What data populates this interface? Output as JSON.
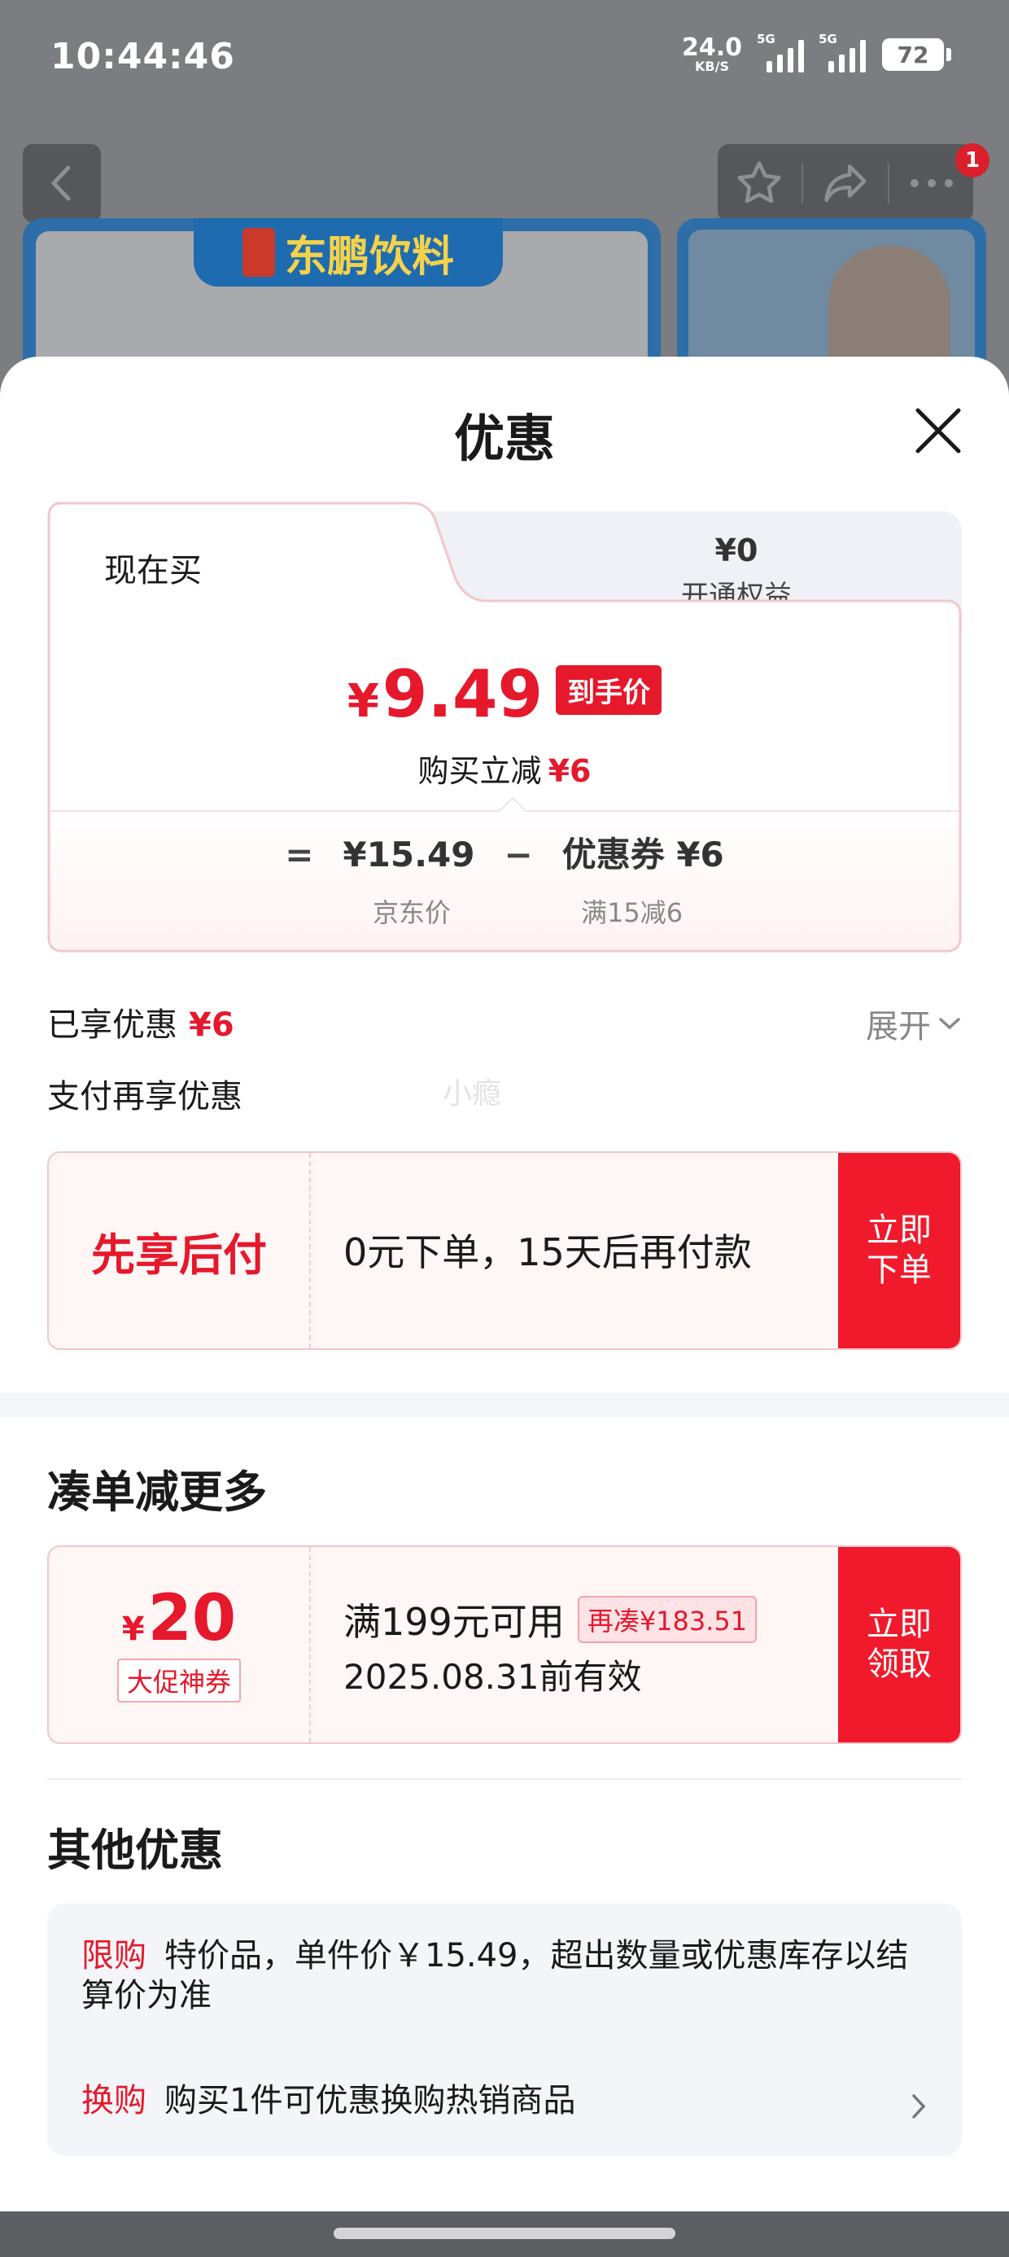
{
  "status_bar": {
    "time": "10:44:46",
    "net_speed": "24.0",
    "net_unit": "KB/S",
    "sim1": "5G",
    "sim2": "5G",
    "battery": "72"
  },
  "background": {
    "badge_count": "1",
    "brand_name": "东鹏饮料"
  },
  "sheet": {
    "title": "优惠",
    "close_icon": "close-icon"
  },
  "price_card": {
    "tab_now": "现在买",
    "tab_member_price": "¥0",
    "tab_member_label": "开通权益",
    "currency": "¥",
    "final_price": "9.49",
    "final_tag": "到手价",
    "reduce_label": "购买立减",
    "reduce_value": "¥6",
    "formula_eq": "=",
    "base_price": "¥15.49",
    "formula_minus": "−",
    "coupon_label": "优惠券 ¥6",
    "base_price_label": "京东价",
    "coupon_rule": "满15减6"
  },
  "enjoyed": {
    "label": "已享优惠",
    "value": "¥6",
    "expand": "展开"
  },
  "pay_section": {
    "label": "支付再享优惠",
    "watermark": "小瘾",
    "title": "先享后付",
    "desc": "0元下单，15天后再付款",
    "cta": "立即\n下单"
  },
  "bundle_section": {
    "title": "凑单减更多",
    "currency": "¥",
    "amount": "20",
    "tag": "大促神券",
    "rule": "满199元可用",
    "pill": "再凑¥183.51",
    "expiry": "2025.08.31前有效",
    "cta": "立即\n领取"
  },
  "other_section": {
    "title": "其他优惠",
    "items": [
      {
        "label": "限购",
        "text": "特价品，单件价￥15.49，超出数量或优惠库存以结算价为准"
      },
      {
        "label": "换购",
        "text": "购买1件可优惠换购热销商品"
      }
    ]
  },
  "colors": {
    "accent_red": "#e6182c",
    "cta_red": "#f01a2c",
    "overlay": "#7b7d81"
  }
}
